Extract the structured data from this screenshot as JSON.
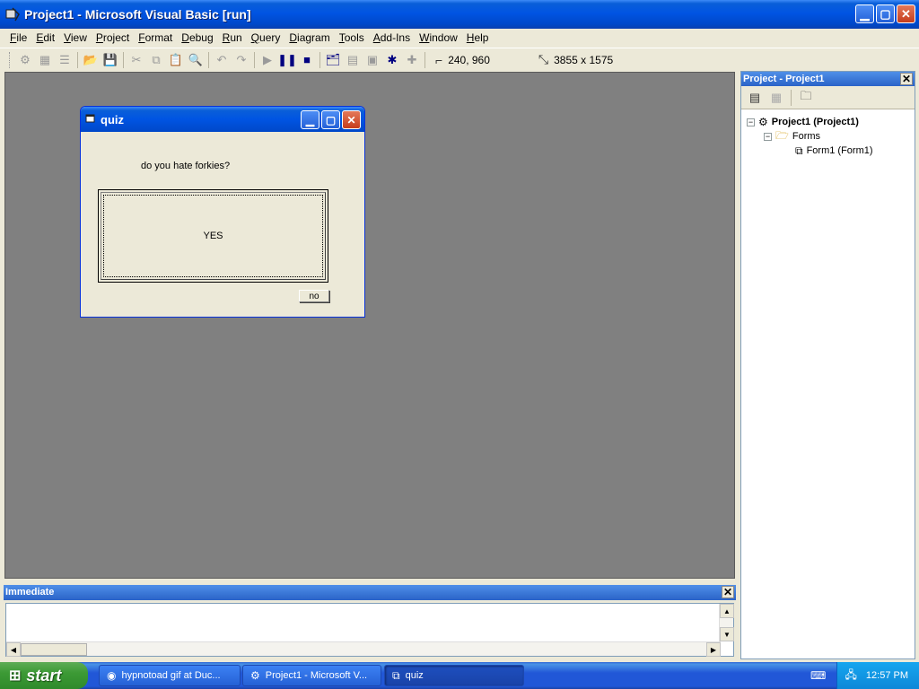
{
  "window": {
    "title": "Project1 - Microsoft Visual Basic [run]"
  },
  "menu": [
    "File",
    "Edit",
    "View",
    "Project",
    "Format",
    "Debug",
    "Run",
    "Query",
    "Diagram",
    "Tools",
    "Add-Ins",
    "Window",
    "Help"
  ],
  "toolbar": {
    "position_readout": "240, 960",
    "size_readout": "3855 x 1575"
  },
  "quiz": {
    "title": "quiz",
    "question": "do you hate forkies?",
    "yes_label": "YES",
    "no_label": "no"
  },
  "project_panel": {
    "title": "Project - Project1",
    "tree": {
      "root": "Project1 (Project1)",
      "folder": "Forms",
      "form": "Form1 (Form1)"
    }
  },
  "immediate": {
    "title": "Immediate"
  },
  "taskbar": {
    "start_label": "start",
    "tasks": [
      "hypnotoad gif at Duc...",
      "Project1 - Microsoft V...",
      "quiz"
    ],
    "clock": "12:57 PM"
  }
}
